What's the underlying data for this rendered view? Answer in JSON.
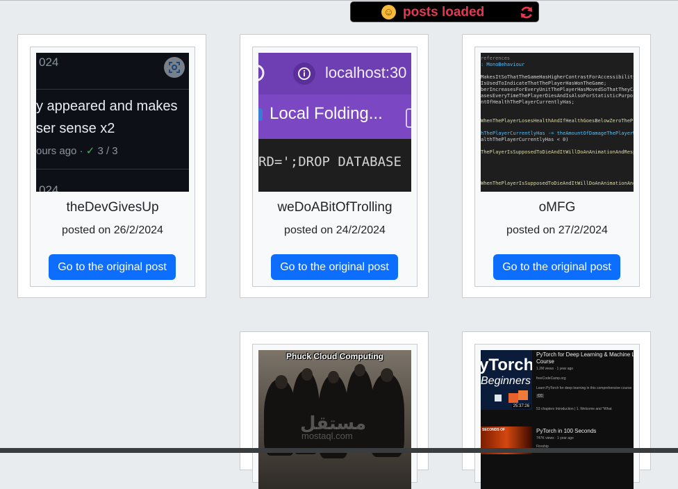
{
  "toast": {
    "emoji": "☺",
    "text": "posts loaded",
    "refresh_icon": "refresh-icon",
    "color": "#e8384f"
  },
  "posts": [
    {
      "title": "theDevGivesUp",
      "date": "posted on 26/2/2024",
      "button": "Go to the original post",
      "thumb": {
        "line1": "024",
        "line2": "y appeared and makes",
        "line3": "ser sense x2",
        "line4a": "ours ago ·",
        "line4b": "✓",
        "line4c": " 3 / 3",
        "line5": "024"
      }
    },
    {
      "title": "weDoABitOfTrolling",
      "date": "posted on 24/2/2024",
      "button": "Go to the original post",
      "thumb": {
        "url": "localhost:30",
        "tab": "Local Folding...",
        "code": "RD=';DROP DATABASE"
      }
    },
    {
      "title": "oMFG",
      "date": "posted on 27/2/2024",
      "button": "Go to the original post",
      "thumb": {
        "lines": [
          "references",
          ": MonoBehaviour",
          "",
          "MakesItSoThatTheGameHasHigherContrastForAccessibility",
          "IsUsedToIndicateThatThePlayerHasWonTheGame;",
          "berIncreasesForEveryUnitThePlayerHasMovedSoThatTheyCa",
          "asesEveryTimeThePlayerDiesAndIsAlsoForStatisticPurpos",
          "ntOfHealthThePlayerCurrentlyHas;",
          "",
          "",
          "WhenThePlayerLosesHealthAndIfHealthGoesBelowZeroTheP",
          "",
          "hThePlayerCurrentlyHas -= theAmountOfDamageThePlayerW",
          "althThePlayerCurrentlyHas < 0)",
          "",
          "ThePlayerIsSupposedToDieAndItWillDoAnAnimationAndResp",
          "",
          "",
          "",
          "",
          "WhenThePlayerIsSupposedToDieAndItWillDoAnAnimationAnd"
        ]
      }
    },
    {
      "title": "",
      "date": "",
      "button": "",
      "thumb": {
        "caption": "Phuck Cloud Computing",
        "watermark": "مستقل",
        "watermark2": "mostaql.com"
      }
    },
    {
      "title": "",
      "date": "",
      "button": "",
      "thumb": {
        "big": "yTorch",
        "sub": "Beginners",
        "title1": "PyTorch for Deep Learning & Machine Lea",
        "title1b": "Course",
        "meta1": "1.2M views · 1 year ago",
        "channel1": "freeCodeCamp.org",
        "desc1": "Learn PyTorch for deep learning in this comprehensive course",
        "badge": "CC",
        "duration": "25:37:26",
        "chapters": "53 chapters   Introduction | 1. Welcome and \"What",
        "title2": "PyTorch in 100 Seconds",
        "meta2": "747K views · 1 year ago",
        "channel2": "Fireship",
        "tag2": "SECONDS OF"
      }
    }
  ]
}
